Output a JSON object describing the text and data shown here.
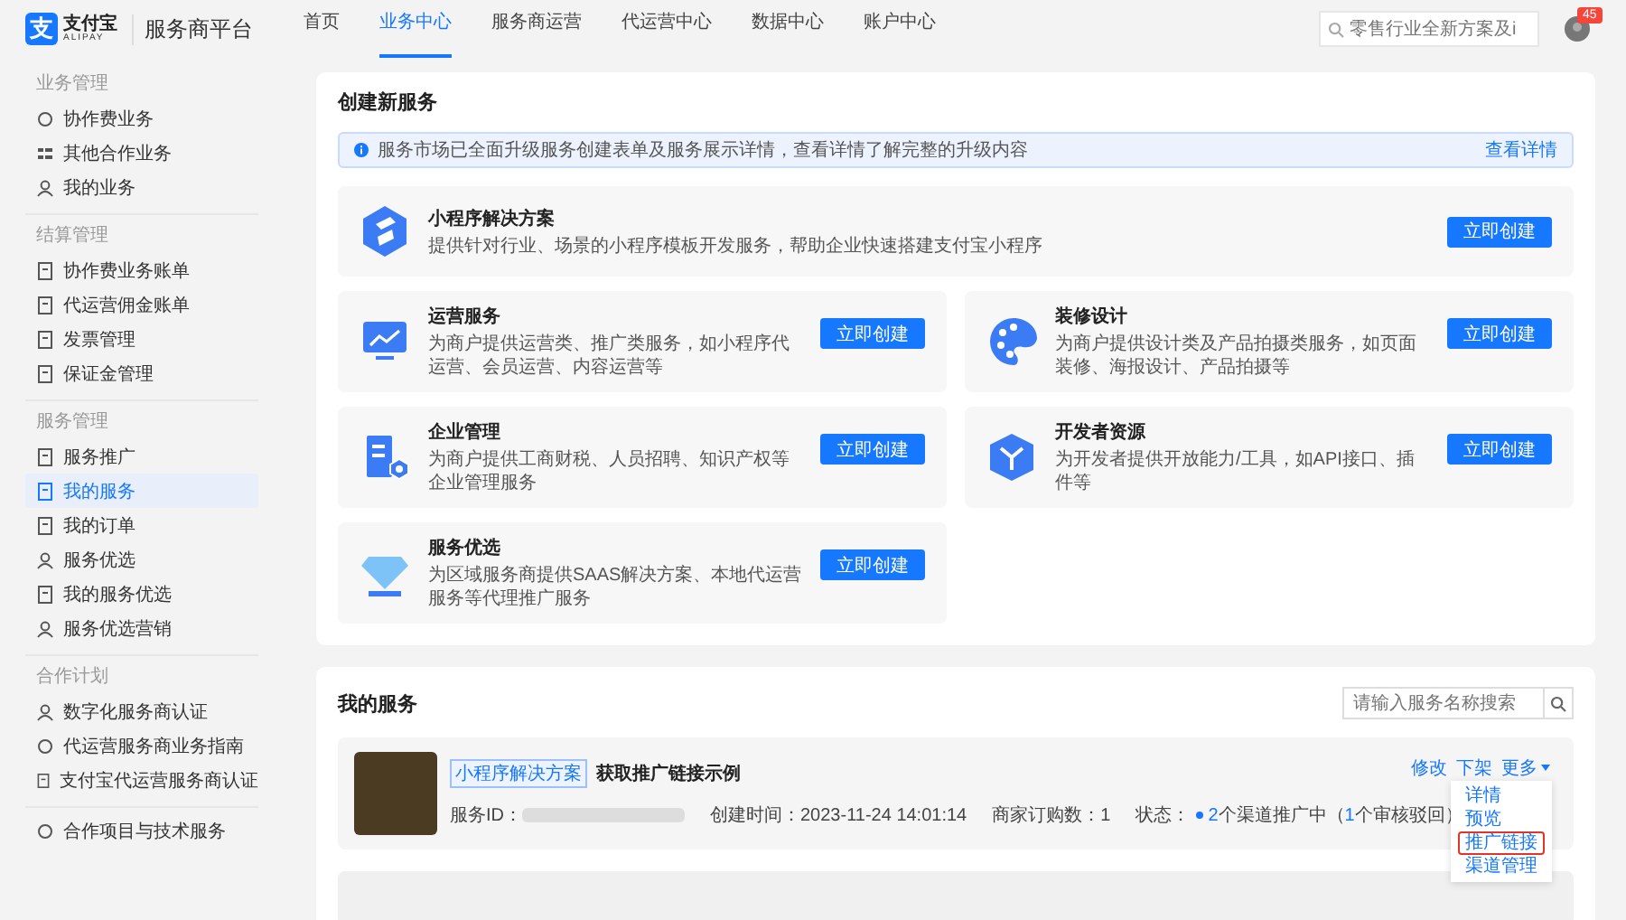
{
  "header": {
    "logo_mark": "支",
    "logo_name": "支付宝",
    "logo_sub": "ALIPAY",
    "platform": "服务商平台",
    "nav": [
      {
        "label": "首页",
        "selected": false
      },
      {
        "label": "业务中心",
        "selected": true
      },
      {
        "label": "服务商运营",
        "selected": false
      },
      {
        "label": "代运营中心",
        "selected": false
      },
      {
        "label": "数据中心",
        "selected": false
      },
      {
        "label": "账户中心",
        "selected": false
      }
    ],
    "search": {
      "placeholder": "零售行业全新方案及i"
    },
    "notification_badge": "45"
  },
  "sidebar": {
    "sections": [
      {
        "title": "业务管理",
        "items": [
          {
            "label": "协作费业务",
            "selected": false
          },
          {
            "label": "其他合作业务",
            "selected": false
          },
          {
            "label": "我的业务",
            "selected": false
          }
        ]
      },
      {
        "title": "结算管理",
        "items": [
          {
            "label": "协作费业务账单",
            "selected": false
          },
          {
            "label": "代运营佣金账单",
            "selected": false
          },
          {
            "label": "发票管理",
            "selected": false
          },
          {
            "label": "保证金管理",
            "selected": false
          }
        ]
      },
      {
        "title": "服务管理",
        "items": [
          {
            "label": "服务推广",
            "selected": false
          },
          {
            "label": "我的服务",
            "selected": true
          },
          {
            "label": "我的订单",
            "selected": false
          },
          {
            "label": "服务优选",
            "selected": false
          },
          {
            "label": "我的服务优选",
            "selected": false
          },
          {
            "label": "服务优选营销",
            "selected": false
          }
        ]
      },
      {
        "title": "合作计划",
        "items": [
          {
            "label": "数字化服务商认证",
            "selected": false
          },
          {
            "label": "代运营服务商业务指南",
            "selected": false
          },
          {
            "label": "支付宝代运营服务商认证",
            "selected": false
          }
        ]
      },
      {
        "items": [
          {
            "label": "合作项目与技术服务",
            "selected": false
          }
        ]
      }
    ]
  },
  "create_panel": {
    "title": "创建新服务",
    "notice": {
      "text": "服务市场已全面升级服务创建表单及服务展示详情，查看详情了解完整的升级内容",
      "link": "查看详情"
    },
    "services": [
      {
        "kind": "wide",
        "title": "小程序解决方案",
        "description": "提供针对行业、场景的小程序模板开发服务，帮助企业快速搭建支付宝小程序",
        "button": "立即创建"
      },
      {
        "kind": "half",
        "title": "运营服务",
        "description": "为商户提供运营类、推广类服务，如小程序代运营、会员运营、内容运营等",
        "button": "立即创建"
      },
      {
        "kind": "half",
        "title": "装修设计",
        "description": "为商户提供设计类及产品拍摄类服务，如页面装修、海报设计、产品拍摄等",
        "button": "立即创建"
      },
      {
        "kind": "half",
        "title": "企业管理",
        "description": "为商户提供工商财税、人员招聘、知识产权等企业管理服务",
        "button": "立即创建"
      },
      {
        "kind": "half",
        "title": "开发者资源",
        "description": "为开发者提供开放能力/工具，如API接口、插件等",
        "button": "立即创建"
      },
      {
        "kind": "half",
        "title": "服务优选",
        "description": "为区域服务商提供SAAS解决方案、本地代运营服务等代理推广服务",
        "button": "立即创建"
      }
    ]
  },
  "my_services": {
    "title": "我的服务",
    "search": {
      "placeholder": "请输入服务名称搜索"
    },
    "items": [
      {
        "tag": "小程序解决方案",
        "name": "获取推广链接示例",
        "id_label": "服务ID：",
        "created": "创建时间：2023-11-24 14:01:14",
        "orders": "商家订购数：1",
        "status_label": "状态：",
        "status": [
          {
            "text": "2",
            "accent": true
          },
          {
            "text": "个渠道推广中（",
            "accent": false
          },
          {
            "text": "1",
            "accent": true
          },
          {
            "text": "个审核驳回）",
            "accent": false
          }
        ],
        "actions": [
          "修改",
          "下架"
        ],
        "more": "更多",
        "menu": [
          {
            "label": "详情",
            "highlighted": false
          },
          {
            "label": "预览",
            "highlighted": false
          },
          {
            "label": "推广链接",
            "highlighted": true
          },
          {
            "label": "渠道管理",
            "highlighted": false
          }
        ]
      }
    ]
  }
}
